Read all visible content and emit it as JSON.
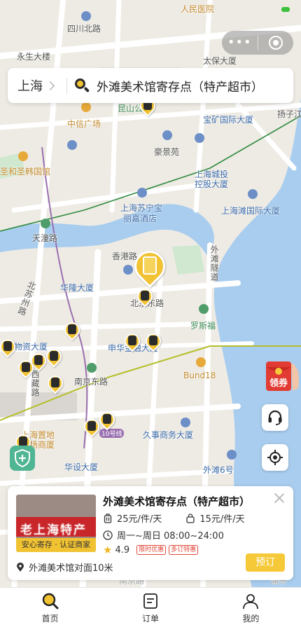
{
  "map": {
    "labels": {
      "sichuan_north_rd": "四川北路",
      "people_hospital": "人民医院",
      "yongsheng": "永生大楼",
      "taibao": "太保大厦",
      "kunshan": "昆山公园",
      "zhongxin_plaza": "中信广场",
      "baokuang": "宝矿国际大厦",
      "yangzijiang": "扬子江",
      "haojing": "豪景苑",
      "church": "圣和圣韩国馆",
      "shanghai_city": "上海城投",
      "holding": "控股大厦",
      "bund_intl": "上海滩国际大厦",
      "suning_1": "上海苏宁宝",
      "suning_2": "丽嘉酒店",
      "tiantong_rd": "天潼路",
      "xianggang_rd": "香港路",
      "huaxia": "华隆大厦",
      "beijing_east": "北京东路",
      "rockbund": "罗斯福",
      "bund_tunnel": "外滩隧道",
      "beisuzhou_rd": "北苏州路",
      "material_bldg": "海物资大厦",
      "zhongyou": "申华金融大厦",
      "nanjing_east": "南京东路",
      "bund18": "Bund18",
      "xizang_rd": "西藏路",
      "zhidi": "上海置地",
      "guangchang": "广场商厦",
      "line10": "10号线",
      "jiushi": "久事商务大厦",
      "huashe": "华设大厦",
      "bund6": "外滩6号",
      "nanjing_rd_station": "南京路",
      "pudong_hint": "浦东"
    }
  },
  "header": {
    "city": "上海",
    "search_text": "外滩美术馆寄存点（特产超市）"
  },
  "capsule": {
    "more": "•••"
  },
  "coupon": {
    "label": "领券"
  },
  "store": {
    "title": "外滩美术馆寄存点（特产超市）",
    "price_large": "25元/件/天",
    "price_small": "15元/件/天",
    "hours": "周一~周日 08:00~24:00",
    "rating": "4.9",
    "tag_limited": "限时优惠",
    "tag_more": "多订特惠",
    "address": "外滩美术馆对面10米",
    "badge": "安心寄存 · 认证商家",
    "sign_text": "老上海特产",
    "book_label": "预订"
  },
  "tabs": [
    {
      "label": "首页"
    },
    {
      "label": "订单"
    },
    {
      "label": "我的"
    }
  ],
  "colors": {
    "accent": "#f1c232",
    "water": "#a9cdee",
    "shield": "#4fb593"
  }
}
